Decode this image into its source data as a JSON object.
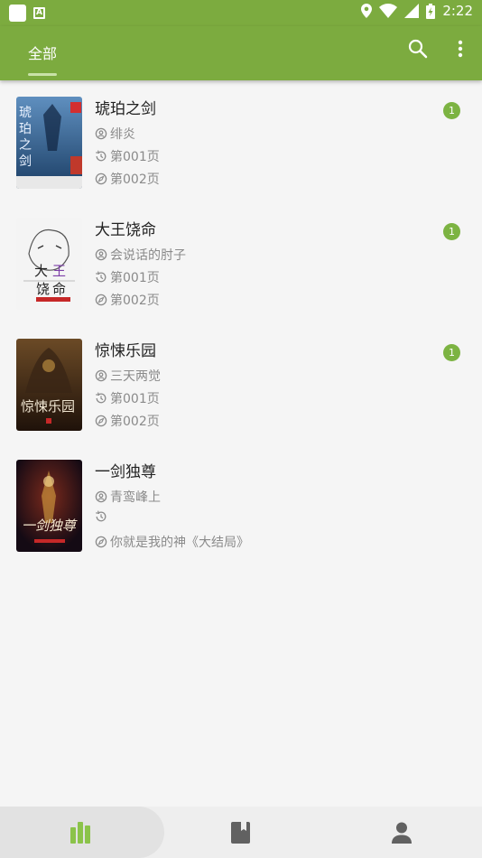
{
  "status_bar": {
    "time": "2:22",
    "icons": [
      "app-square-icon",
      "a-notification-icon",
      "location-icon",
      "wifi-icon",
      "signal-icon",
      "battery-charging-icon"
    ]
  },
  "toolbar": {
    "tab_label": "全部",
    "search_icon": "search-icon",
    "more_icon": "more-vert-icon"
  },
  "books": [
    {
      "title": "琥珀之剑",
      "author": "绯炎",
      "last_read": "第001页",
      "latest": "第002页",
      "badge": "1",
      "cover_text": "琥珀之剑",
      "cover_sub": "绯炎",
      "cover_colors": [
        "#1c3f66",
        "#5f8fbf"
      ]
    },
    {
      "title": "大王饶命",
      "author": "会说话的肘子",
      "last_read": "第001页",
      "latest": "第002页",
      "badge": "1",
      "cover_text": "大王饶命",
      "cover_sub": "",
      "cover_colors": [
        "#f2f2f2",
        "#cfcfcf"
      ]
    },
    {
      "title": "惊悚乐园",
      "author": "三天两觉",
      "last_read": "第001页",
      "latest": "第002页",
      "badge": "1",
      "cover_text": "惊悚乐园",
      "cover_sub": "",
      "cover_colors": [
        "#2a1a0e",
        "#6b4a26"
      ]
    },
    {
      "title": "一剑独尊",
      "author": "青鸾峰上",
      "last_read": "",
      "latest": "你就是我的神《大结局》",
      "badge": "",
      "cover_text": "一剑独尊",
      "cover_sub": "",
      "cover_colors": [
        "#1a0f1a",
        "#7a2a1c"
      ]
    }
  ],
  "bottom_nav": {
    "items": [
      "bookshelf-icon",
      "book-icon",
      "profile-icon"
    ],
    "active_index": 0,
    "active_color": "#8bc34a",
    "inactive_color": "#616161"
  }
}
